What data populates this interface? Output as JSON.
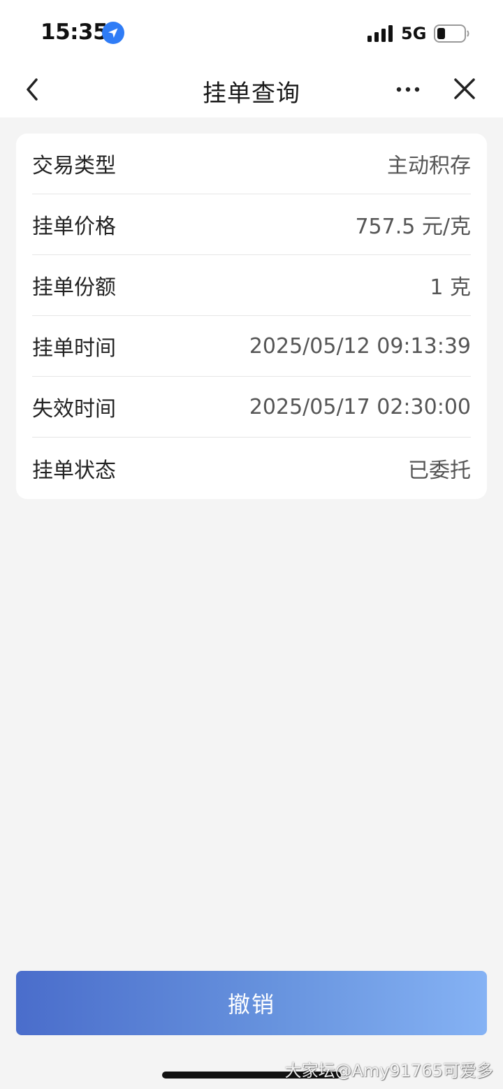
{
  "status_bar": {
    "time": "15:35",
    "network": "5G",
    "icons": [
      "location-arrow-icon",
      "signal-bars-icon",
      "battery-icon"
    ]
  },
  "nav": {
    "title": "挂单查询",
    "icons": [
      "back-chevron-icon",
      "more-dots-icon",
      "close-x-icon"
    ]
  },
  "details": [
    {
      "label": "交易类型",
      "value": "主动积存"
    },
    {
      "label": "挂单价格",
      "value": "757.5 元/克"
    },
    {
      "label": "挂单份额",
      "value": "1 克"
    },
    {
      "label": "挂单时间",
      "value": "2025/05/12 09:13:39"
    },
    {
      "label": "失效时间",
      "value": "2025/05/17 02:30:00"
    },
    {
      "label": "挂单状态",
      "value": "已委托"
    }
  ],
  "cancel_button": {
    "label": "撤销"
  },
  "watermark": "大家坛@Amy91765可爱多",
  "colors": {
    "background": "#f4f4f4",
    "card": "#ffffff",
    "button_gradient_start": "#4a6dcb",
    "button_gradient_end": "#85b2f4",
    "location_icon": "#2f7cf6"
  }
}
